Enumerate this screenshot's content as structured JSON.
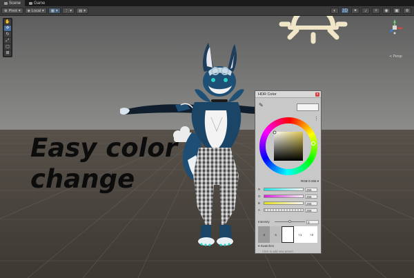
{
  "tabs": [
    {
      "label": "Scene",
      "active": true
    },
    {
      "label": "Game",
      "active": false
    }
  ],
  "toolbar": {
    "pivot_label": "Pivot",
    "local_label": "Local"
  },
  "caption": {
    "line1": "Easy color",
    "line2": "change"
  },
  "gizmo": {
    "projection_label": "≺ Persp"
  },
  "hdr_color": {
    "title": "HDR Color",
    "mode": "RGB 0-255",
    "channels": [
      {
        "label": "R",
        "value": "255"
      },
      {
        "label": "G",
        "value": "255"
      },
      {
        "label": "B",
        "value": "255"
      },
      {
        "label": "A",
        "value": "255"
      }
    ],
    "intensity_label": "Intensity",
    "intensity_value": "0",
    "presets": [
      "-2",
      "-1",
      "",
      "+1",
      "+2"
    ],
    "swatches_label": "Swatches",
    "swatches_hint": "Click to add new preset"
  },
  "colors": {
    "sky": "#777777",
    "ground": "#4d463c",
    "caption": "#0c0c0c",
    "sun": "#f1e5c7",
    "close": "#d64040",
    "selection": "#46607c"
  }
}
